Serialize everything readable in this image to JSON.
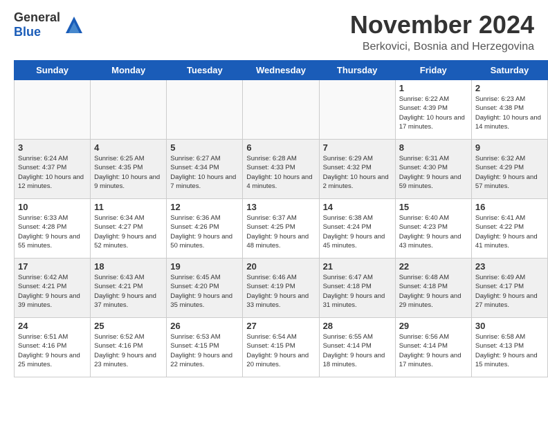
{
  "header": {
    "logo_general": "General",
    "logo_blue": "Blue",
    "month_title": "November 2024",
    "location": "Berkovici, Bosnia and Herzegovina"
  },
  "days_of_week": [
    "Sunday",
    "Monday",
    "Tuesday",
    "Wednesday",
    "Thursday",
    "Friday",
    "Saturday"
  ],
  "weeks": [
    [
      {
        "day": "",
        "info": "",
        "empty": true
      },
      {
        "day": "",
        "info": "",
        "empty": true
      },
      {
        "day": "",
        "info": "",
        "empty": true
      },
      {
        "day": "",
        "info": "",
        "empty": true
      },
      {
        "day": "",
        "info": "",
        "empty": true
      },
      {
        "day": "1",
        "info": "Sunrise: 6:22 AM\nSunset: 4:39 PM\nDaylight: 10 hours and 17 minutes.",
        "empty": false
      },
      {
        "day": "2",
        "info": "Sunrise: 6:23 AM\nSunset: 4:38 PM\nDaylight: 10 hours and 14 minutes.",
        "empty": false
      }
    ],
    [
      {
        "day": "3",
        "info": "Sunrise: 6:24 AM\nSunset: 4:37 PM\nDaylight: 10 hours and 12 minutes.",
        "empty": false
      },
      {
        "day": "4",
        "info": "Sunrise: 6:25 AM\nSunset: 4:35 PM\nDaylight: 10 hours and 9 minutes.",
        "empty": false
      },
      {
        "day": "5",
        "info": "Sunrise: 6:27 AM\nSunset: 4:34 PM\nDaylight: 10 hours and 7 minutes.",
        "empty": false
      },
      {
        "day": "6",
        "info": "Sunrise: 6:28 AM\nSunset: 4:33 PM\nDaylight: 10 hours and 4 minutes.",
        "empty": false
      },
      {
        "day": "7",
        "info": "Sunrise: 6:29 AM\nSunset: 4:32 PM\nDaylight: 10 hours and 2 minutes.",
        "empty": false
      },
      {
        "day": "8",
        "info": "Sunrise: 6:31 AM\nSunset: 4:30 PM\nDaylight: 9 hours and 59 minutes.",
        "empty": false
      },
      {
        "day": "9",
        "info": "Sunrise: 6:32 AM\nSunset: 4:29 PM\nDaylight: 9 hours and 57 minutes.",
        "empty": false
      }
    ],
    [
      {
        "day": "10",
        "info": "Sunrise: 6:33 AM\nSunset: 4:28 PM\nDaylight: 9 hours and 55 minutes.",
        "empty": false
      },
      {
        "day": "11",
        "info": "Sunrise: 6:34 AM\nSunset: 4:27 PM\nDaylight: 9 hours and 52 minutes.",
        "empty": false
      },
      {
        "day": "12",
        "info": "Sunrise: 6:36 AM\nSunset: 4:26 PM\nDaylight: 9 hours and 50 minutes.",
        "empty": false
      },
      {
        "day": "13",
        "info": "Sunrise: 6:37 AM\nSunset: 4:25 PM\nDaylight: 9 hours and 48 minutes.",
        "empty": false
      },
      {
        "day": "14",
        "info": "Sunrise: 6:38 AM\nSunset: 4:24 PM\nDaylight: 9 hours and 45 minutes.",
        "empty": false
      },
      {
        "day": "15",
        "info": "Sunrise: 6:40 AM\nSunset: 4:23 PM\nDaylight: 9 hours and 43 minutes.",
        "empty": false
      },
      {
        "day": "16",
        "info": "Sunrise: 6:41 AM\nSunset: 4:22 PM\nDaylight: 9 hours and 41 minutes.",
        "empty": false
      }
    ],
    [
      {
        "day": "17",
        "info": "Sunrise: 6:42 AM\nSunset: 4:21 PM\nDaylight: 9 hours and 39 minutes.",
        "empty": false
      },
      {
        "day": "18",
        "info": "Sunrise: 6:43 AM\nSunset: 4:21 PM\nDaylight: 9 hours and 37 minutes.",
        "empty": false
      },
      {
        "day": "19",
        "info": "Sunrise: 6:45 AM\nSunset: 4:20 PM\nDaylight: 9 hours and 35 minutes.",
        "empty": false
      },
      {
        "day": "20",
        "info": "Sunrise: 6:46 AM\nSunset: 4:19 PM\nDaylight: 9 hours and 33 minutes.",
        "empty": false
      },
      {
        "day": "21",
        "info": "Sunrise: 6:47 AM\nSunset: 4:18 PM\nDaylight: 9 hours and 31 minutes.",
        "empty": false
      },
      {
        "day": "22",
        "info": "Sunrise: 6:48 AM\nSunset: 4:18 PM\nDaylight: 9 hours and 29 minutes.",
        "empty": false
      },
      {
        "day": "23",
        "info": "Sunrise: 6:49 AM\nSunset: 4:17 PM\nDaylight: 9 hours and 27 minutes.",
        "empty": false
      }
    ],
    [
      {
        "day": "24",
        "info": "Sunrise: 6:51 AM\nSunset: 4:16 PM\nDaylight: 9 hours and 25 minutes.",
        "empty": false
      },
      {
        "day": "25",
        "info": "Sunrise: 6:52 AM\nSunset: 4:16 PM\nDaylight: 9 hours and 23 minutes.",
        "empty": false
      },
      {
        "day": "26",
        "info": "Sunrise: 6:53 AM\nSunset: 4:15 PM\nDaylight: 9 hours and 22 minutes.",
        "empty": false
      },
      {
        "day": "27",
        "info": "Sunrise: 6:54 AM\nSunset: 4:15 PM\nDaylight: 9 hours and 20 minutes.",
        "empty": false
      },
      {
        "day": "28",
        "info": "Sunrise: 6:55 AM\nSunset: 4:14 PM\nDaylight: 9 hours and 18 minutes.",
        "empty": false
      },
      {
        "day": "29",
        "info": "Sunrise: 6:56 AM\nSunset: 4:14 PM\nDaylight: 9 hours and 17 minutes.",
        "empty": false
      },
      {
        "day": "30",
        "info": "Sunrise: 6:58 AM\nSunset: 4:13 PM\nDaylight: 9 hours and 15 minutes.",
        "empty": false
      }
    ]
  ]
}
